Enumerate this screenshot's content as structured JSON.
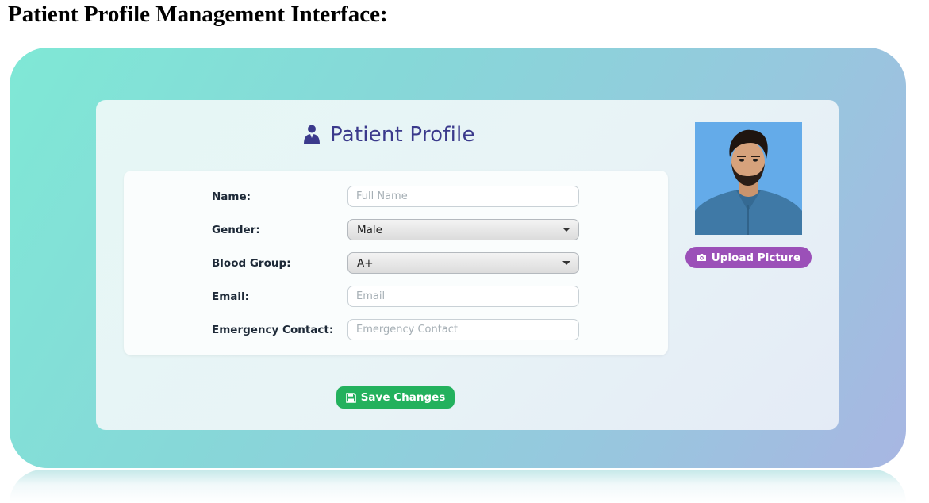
{
  "document": {
    "title": "Patient Profile Management Interface:"
  },
  "profile": {
    "title": "Patient Profile",
    "title_icon": "user-icon",
    "accent_color": "#3b3a8c"
  },
  "form": {
    "name": {
      "label": "Name:",
      "placeholder": "Full Name",
      "value": ""
    },
    "gender": {
      "label": "Gender:",
      "value": "Male"
    },
    "blood_group": {
      "label": "Blood Group:",
      "value": "A+"
    },
    "email": {
      "label": "Email:",
      "placeholder": "Email",
      "value": ""
    },
    "emergency_contact": {
      "label": "Emergency Contact:",
      "placeholder": "Emergency Contact",
      "value": ""
    }
  },
  "photo": {
    "upload_label": "Upload Picture",
    "upload_icon": "camera-icon",
    "button_color": "#9b50b8"
  },
  "actions": {
    "save_label": "Save Changes",
    "save_icon": "save-icon",
    "save_color": "#23b15d"
  }
}
